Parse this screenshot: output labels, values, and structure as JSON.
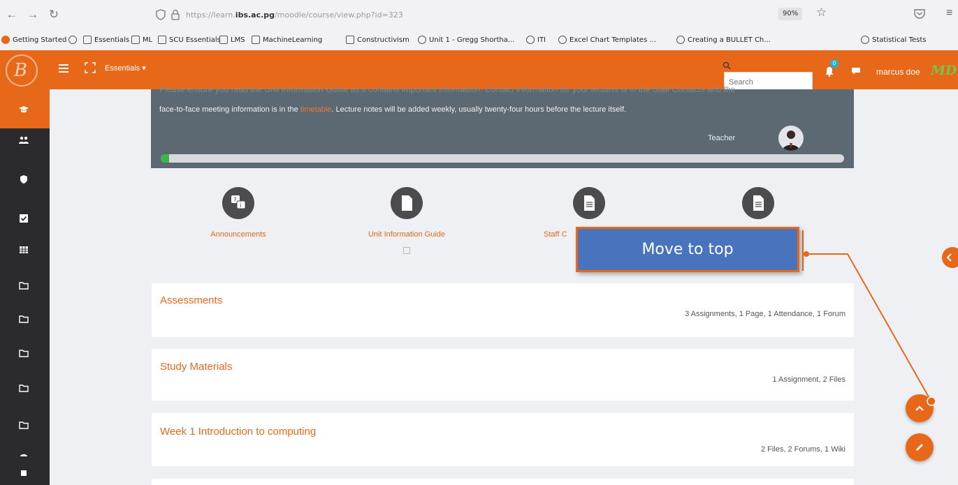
{
  "browser": {
    "url_prefix": "https://learn.",
    "url_domain": "ibs.ac.pg",
    "url_path": "/moodle/course/view.php?id=323",
    "zoom": "90%",
    "bookmarks": [
      "Getting Started",
      "Essentials",
      "ML",
      "SCU Essentials",
      "LMS",
      "MachineLearning",
      "Constructivism",
      "Unit 1 - Gregg Shortha...",
      "ITI",
      "Excel Chart Templates ...",
      "Creating a BULLET Ch...",
      "Statistical Tests"
    ]
  },
  "header": {
    "logo_letter": "B",
    "course_menu": "Essentials ▾",
    "search_placeholder": "Search",
    "notification_count": "0",
    "user_name": "marcus doe",
    "avatar_initials": "MD"
  },
  "banner": {
    "top_text": "Please ensure you read the Unit Information Guide as it contains important information. Contact information for your lecturer is in the Staff Contacts and the",
    "line2_before": "face-to-face meeting information is in the ",
    "line2_link": "timetable",
    "line2_after": ". Lecture notes will be added weekly, usually twenty-four hours before the lecture itself.",
    "teacher_label": "Teacher",
    "progress_fraction": 0.012
  },
  "resources": [
    {
      "label": "Announcements",
      "icon": "forum-icon"
    },
    {
      "label": "Unit Information Guide",
      "icon": "file-icon"
    },
    {
      "label": "Staff C",
      "icon": "file-icon"
    },
    {
      "label": "",
      "icon": "file-icon"
    }
  ],
  "sections": [
    {
      "title": "Assessments",
      "summary": "3 Assignments, 1 Page, 1 Attendance, 1 Forum"
    },
    {
      "title": "Study Materials",
      "summary": "1 Assignment, 2 Files"
    },
    {
      "title": "Week 1 Introduction to computing",
      "summary": "2 Files, 2 Forums, 1 Wiki"
    }
  ],
  "callout": {
    "text": "Move to top"
  },
  "colors": {
    "accent": "#e8681a",
    "sidebar": "#2b2b2e",
    "callout": "#4a73bd"
  }
}
